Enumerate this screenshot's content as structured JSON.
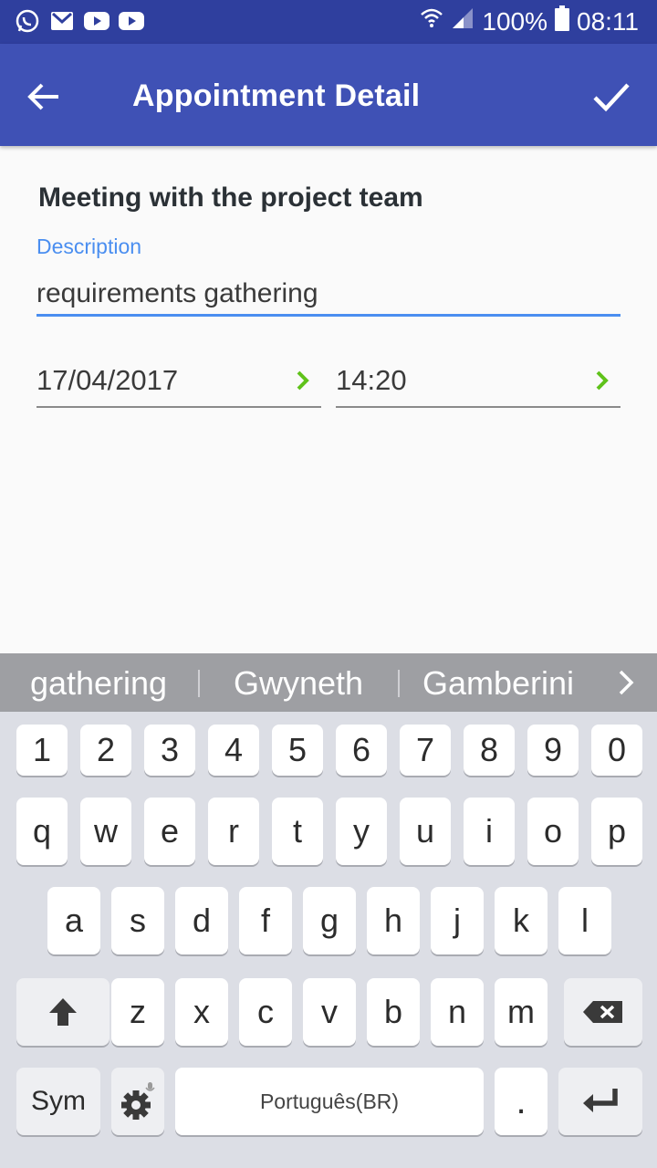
{
  "status_bar": {
    "battery_percent": "100%",
    "time": "08:11",
    "notification_icons": [
      "whatsapp-icon",
      "gmail-icon",
      "youtube-icon",
      "youtube-icon"
    ]
  },
  "app_bar": {
    "title": "Appointment Detail"
  },
  "form": {
    "title": "Meeting with the project team",
    "description_label": "Description",
    "description_value": "requirements gathering",
    "date": "17/04/2017",
    "time": "14:20"
  },
  "keyboard": {
    "suggestions": [
      "gathering",
      "Gwyneth",
      "Gamberini"
    ],
    "row_numbers": [
      "1",
      "2",
      "3",
      "4",
      "5",
      "6",
      "7",
      "8",
      "9",
      "0"
    ],
    "row1": [
      "q",
      "w",
      "e",
      "r",
      "t",
      "y",
      "u",
      "i",
      "o",
      "p"
    ],
    "row2": [
      "a",
      "s",
      "d",
      "f",
      "g",
      "h",
      "j",
      "k",
      "l"
    ],
    "row3": [
      "z",
      "x",
      "c",
      "v",
      "b",
      "n",
      "m"
    ],
    "sym_label": "Sym",
    "space_label": "Português(BR)",
    "period_label": "."
  },
  "colors": {
    "status_bar": "#2f3f9e",
    "app_bar": "#3f51b5",
    "accent": "#4a8ef0",
    "chevron": "#5fc21a"
  }
}
